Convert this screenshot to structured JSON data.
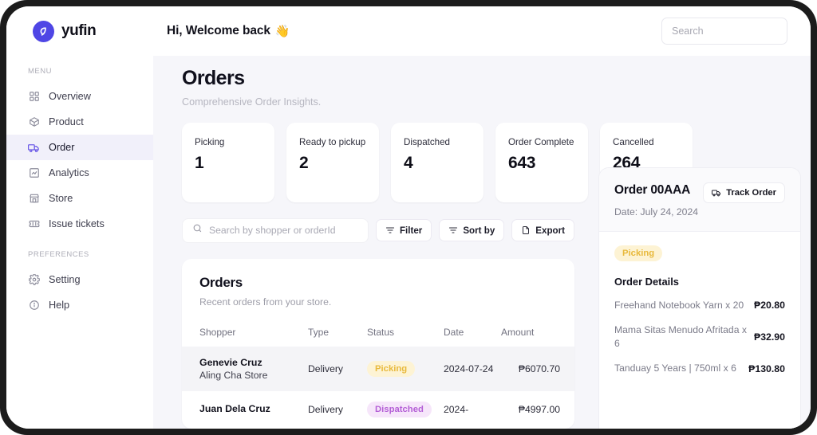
{
  "brand": {
    "name": "yufin",
    "logo_icon": "yufin-leaf-logo"
  },
  "header": {
    "welcome": "Hi, Welcome back",
    "wave_emoji": "👋",
    "search_placeholder": "Search",
    "search_value": ""
  },
  "sidebar": {
    "menu_label": "MENU",
    "preferences_label": "PREFERENCES",
    "menu_items": [
      {
        "label": "Overview",
        "icon": "grid-icon",
        "active": false
      },
      {
        "label": "Product",
        "icon": "box-icon",
        "active": false
      },
      {
        "label": "Order",
        "icon": "truck-icon",
        "active": true
      },
      {
        "label": "Analytics",
        "icon": "chart-icon",
        "active": false
      },
      {
        "label": "Store",
        "icon": "store-icon",
        "active": false
      },
      {
        "label": "Issue tickets",
        "icon": "ticket-icon",
        "active": false
      }
    ],
    "preference_items": [
      {
        "label": "Setting",
        "icon": "gear-icon",
        "active": false
      },
      {
        "label": "Help",
        "icon": "info-icon",
        "active": false
      }
    ]
  },
  "page": {
    "title": "Orders",
    "subtitle": "Comprehensive Order Insights."
  },
  "stats": [
    {
      "label": "Picking",
      "value": "1"
    },
    {
      "label": "Ready to pickup",
      "value": "2"
    },
    {
      "label": "Dispatched",
      "value": "4"
    },
    {
      "label": "Order Complete",
      "value": "643"
    },
    {
      "label": "Cancelled",
      "value": "264"
    }
  ],
  "toolbar": {
    "search_placeholder": "Search by shopper or orderId",
    "search_value": "",
    "search_icon": "search-icon",
    "filter_label": "Filter",
    "filter_icon": "filter-icon",
    "sort_label": "Sort by",
    "sort_icon": "sort-icon",
    "export_label": "Export",
    "export_icon": "file-icon"
  },
  "orders_card": {
    "title": "Orders",
    "subtitle": "Recent orders from your store.",
    "columns": [
      "Shopper",
      "Type",
      "Status",
      "Date",
      "Amount"
    ],
    "rows": [
      {
        "shopper_name": "Genevie Cruz",
        "shopper_store": "Aling Cha Store",
        "type": "Delivery",
        "status": "Picking",
        "status_kind": "picking",
        "date": "2024-07-24",
        "amount": "₱6070.70"
      },
      {
        "shopper_name": "Juan Dela Cruz",
        "shopper_store": "",
        "type": "Delivery",
        "status": "Dispatched",
        "status_kind": "dispatched",
        "date": "2024-",
        "amount": "₱4997.00"
      }
    ]
  },
  "order_panel": {
    "title": "Order 00AAA",
    "date": "Date: July 24, 2024",
    "track_label": "Track Order",
    "track_icon": "truck-icon",
    "status": "Picking",
    "details_title": "Order Details",
    "items": [
      {
        "name": "Freehand Notebook Yarn x 20",
        "price": "₱20.80"
      },
      {
        "name": "Mama Sitas Menudo Afritada x 6",
        "price": "₱32.90"
      },
      {
        "name": "Tanduay 5 Years | 750ml x 6",
        "price": "₱130.80"
      }
    ]
  },
  "colors": {
    "accent": "#6d5ce7",
    "brand": "#4f46e5",
    "page_bg": "#f6f6fa",
    "picking_bg": "#fdf3d4",
    "picking_fg": "#e8b93c",
    "dispatched_bg": "#f6e6fa",
    "dispatched_fg": "#b45fd6"
  }
}
